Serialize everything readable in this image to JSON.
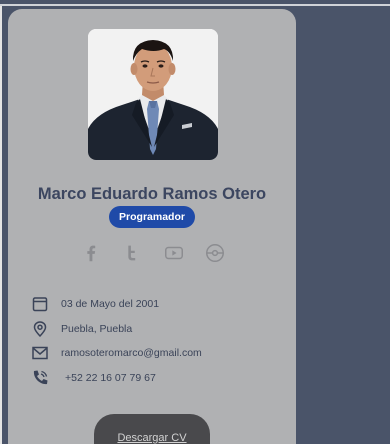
{
  "profile": {
    "name": "Marco Eduardo Ramos Otero",
    "role": "Programador",
    "photo": "portrait-photo"
  },
  "social": [
    {
      "icon": "facebook-icon"
    },
    {
      "icon": "twitter-icon"
    },
    {
      "icon": "youtube-icon"
    },
    {
      "icon": "record-icon"
    }
  ],
  "info": {
    "birthday": "03 de Mayo del 2001",
    "location": "Puebla, Puebla",
    "email": "ramosoteromarco@gmail.com",
    "phone": "+52 22 16 07 79 67"
  },
  "actions": {
    "cv_label": "Descargar CV"
  },
  "colors": {
    "background": "#4a5469",
    "card": "#b0b1b3",
    "badge": "#1f4aa8",
    "name": "#3c4660",
    "button": "#49494c"
  }
}
